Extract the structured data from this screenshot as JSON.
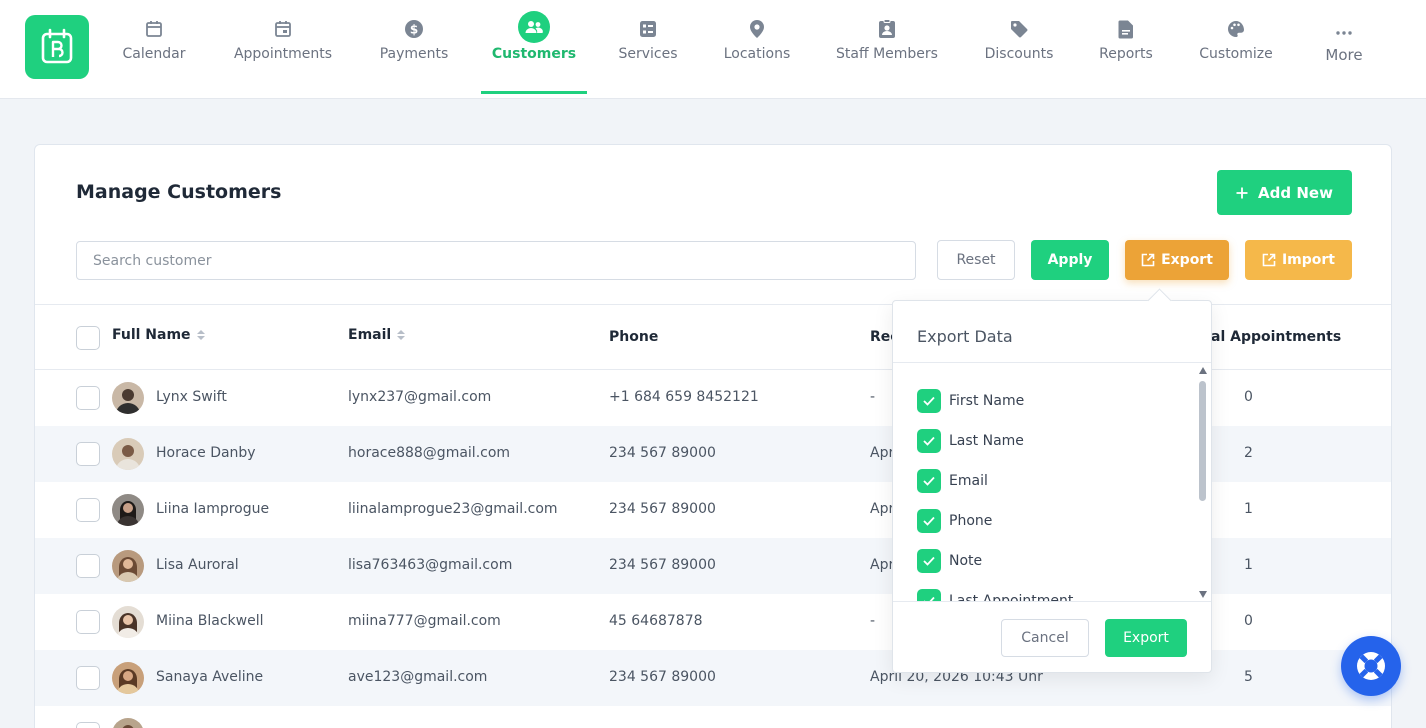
{
  "nav": {
    "items": [
      {
        "label": "Calendar",
        "icon": "calendar-icon"
      },
      {
        "label": "Appointments",
        "icon": "calendar-check-icon"
      },
      {
        "label": "Payments",
        "icon": "dollar-icon"
      },
      {
        "label": "Customers",
        "icon": "users-icon",
        "active": true
      },
      {
        "label": "Services",
        "icon": "list-icon"
      },
      {
        "label": "Locations",
        "icon": "map-pin-icon"
      },
      {
        "label": "Staff Members",
        "icon": "id-badge-icon"
      },
      {
        "label": "Discounts",
        "icon": "tag-icon"
      },
      {
        "label": "Reports",
        "icon": "report-icon"
      },
      {
        "label": "Customize",
        "icon": "palette-icon"
      },
      {
        "label": "More",
        "icon": "dots-icon"
      }
    ]
  },
  "page": {
    "title": "Manage Customers",
    "add_new_label": "Add New",
    "search_placeholder": "Search customer",
    "reset_label": "Reset",
    "apply_label": "Apply",
    "export_label": "Export",
    "import_label": "Import"
  },
  "table": {
    "columns": {
      "full_name": "Full Name",
      "email": "Email",
      "phone": "Phone",
      "recent": "Rec",
      "total_appointments": "al Appointments"
    },
    "rows": [
      {
        "name": "Lynx Swift",
        "email": "lynx237@gmail.com",
        "phone": "+1 684 659 8452121",
        "recent": "-",
        "total": "0"
      },
      {
        "name": "Horace Danby",
        "email": "horace888@gmail.com",
        "phone": "234 567 89000",
        "recent": "Apr",
        "total": "2"
      },
      {
        "name": "Liina Iamprogue",
        "email": "liinalamprogue23@gmail.com",
        "phone": "234 567 89000",
        "recent": "Apr",
        "total": "1"
      },
      {
        "name": "Lisa Auroral",
        "email": "lisa763463@gmail.com",
        "phone": "234 567 89000",
        "recent": "Apr",
        "total": "1"
      },
      {
        "name": "Miina Blackwell",
        "email": "miina777@gmail.com",
        "phone": "45 64687878",
        "recent": "-",
        "total": "0"
      },
      {
        "name": "Sanaya Aveline",
        "email": "ave123@gmail.com",
        "phone": "234 567 89000",
        "recent": "April 20, 2026 10:43 Uhr",
        "total": "5"
      }
    ]
  },
  "export_dropdown": {
    "title": "Export Data",
    "options": [
      "First Name",
      "Last Name",
      "Email",
      "Phone",
      "Note",
      "Last Appointment"
    ],
    "cancel_label": "Cancel",
    "export_label": "Export"
  },
  "colors": {
    "primary": "#1fd07f",
    "export_orange": "#eca337",
    "import_orange": "#f5b84a",
    "help_blue": "#2563eb"
  }
}
